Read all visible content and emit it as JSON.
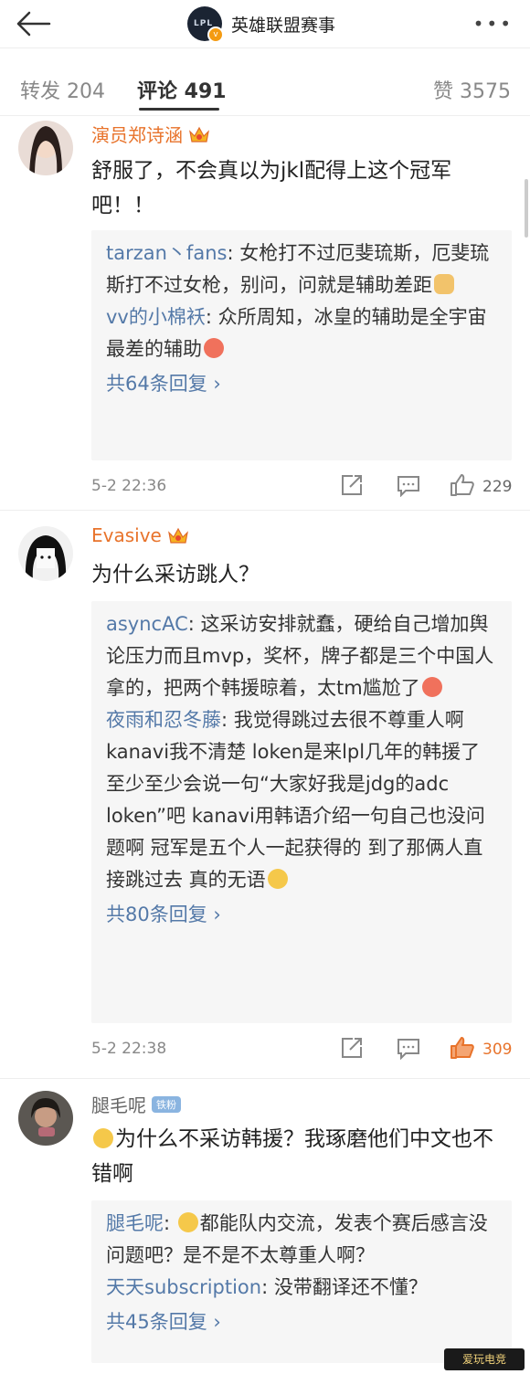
{
  "header": {
    "title": "英雄联盟赛事",
    "logo_text": "LPL"
  },
  "tabs": [
    {
      "label": "转发 204"
    },
    {
      "label": "评论 491"
    },
    {
      "label": "赞 3575"
    }
  ],
  "comments": [
    {
      "username": "演员郑诗涵",
      "text": "舒服了，不会真以为jkl配得上这个冠军吧！！",
      "replies": [
        {
          "user": "tarzan丶fans",
          "text": "女枪打不过厄斐琉斯，厄斐琉斯打不过女枪，别问，问就是辅助差距"
        },
        {
          "user": "vv的小棉袄",
          "text": "众所周知，冰皇的辅助是全宇宙最差的辅助"
        }
      ],
      "more_replies": "共64条回复",
      "time": "5-2 22:36",
      "likes": "229"
    },
    {
      "username": "Evasive",
      "text": "为什么采访跳人？",
      "replies": [
        {
          "user": "asyncAC",
          "text": "这采访安排就蠢，硬给自己增加舆论压力而且mvp，奖杯，牌子都是三个中国人拿的，把两个韩援晾着，太tm尴尬了"
        },
        {
          "user": "夜雨和忍冬藤",
          "text": "我觉得跳过去很不尊重人啊 kanavi我不清楚 loken是来lpl几年的韩援了 至少至少会说一句“大家好我是jdg的adc loken”吧 kanavi用韩语介绍一句自己也没问题啊 冠军是五个人一起获得的 到了那俩人直接跳过去 真的无语"
        }
      ],
      "more_replies": "共80条回复",
      "time": "5-2 22:38",
      "likes": "309"
    },
    {
      "username": "腿毛呢",
      "badge": "铁粉",
      "text": "为什么不采访韩援？我琢磨他们中文也不错啊",
      "replies": [
        {
          "user": "腿毛呢",
          "text": "都能队内交流，发表个赛后感言没问题吧？是不是不太尊重人啊？"
        },
        {
          "user": "天天subscription",
          "text": "没带翻译还不懂？"
        }
      ],
      "more_replies": "共45条回复"
    }
  ],
  "watermark": "爱玩电竞",
  "colors": {
    "accent_orange": "#e8732b",
    "link_blue": "#5479a8",
    "reply_bg": "#f6f6f6"
  }
}
